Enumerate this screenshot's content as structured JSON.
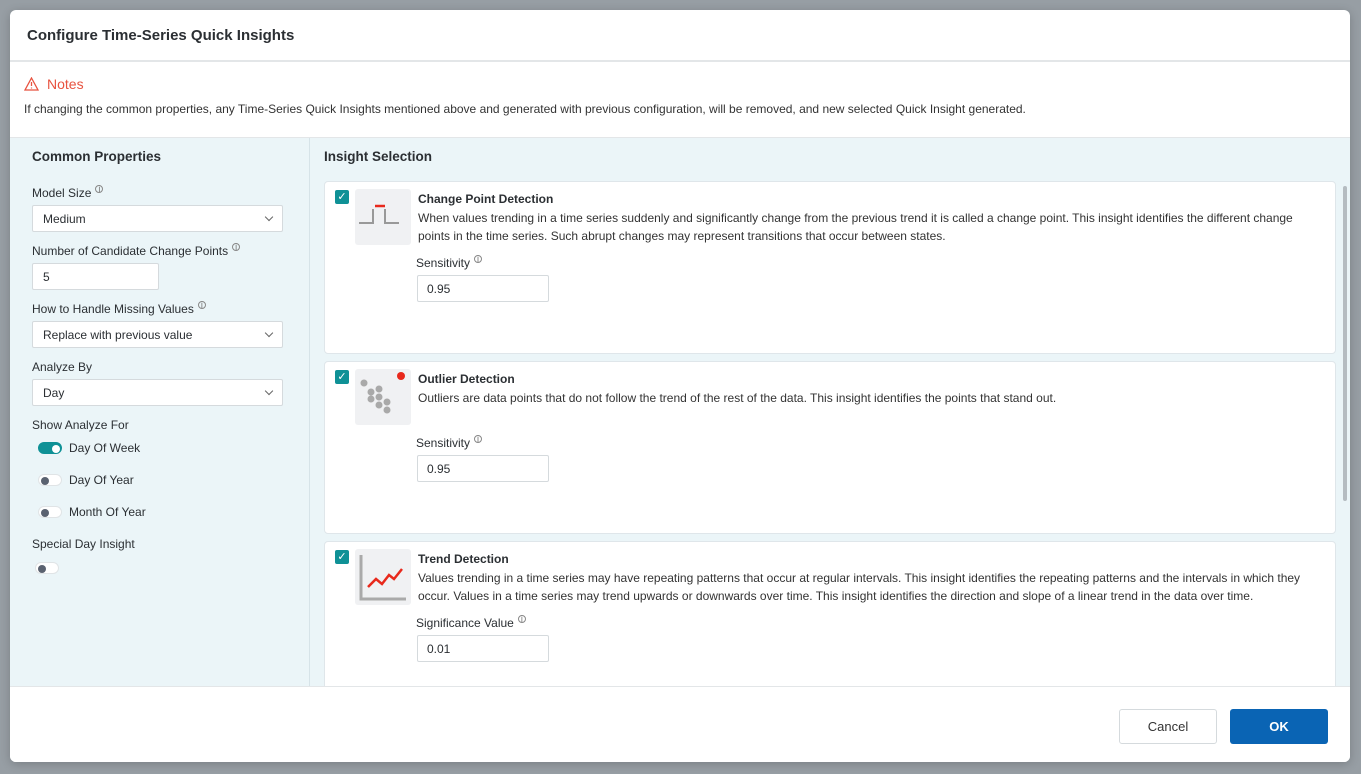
{
  "dialog": {
    "title": "Configure Time-Series Quick Insights"
  },
  "notes": {
    "title": "Notes",
    "text": "If changing the common properties, any Time-Series Quick Insights mentioned above and generated with previous configuration, will be removed, and new selected Quick Insight generated."
  },
  "common": {
    "title": "Common Properties",
    "model_size": {
      "label": "Model Size",
      "value": "Medium"
    },
    "candidates": {
      "label": "Number of Candidate Change Points",
      "value": "5"
    },
    "missing": {
      "label": "How to Handle Missing Values",
      "value": "Replace with previous value"
    },
    "analyze_by": {
      "label": "Analyze By",
      "value": "Day"
    },
    "show_for": {
      "label": "Show Analyze For",
      "items": [
        {
          "label": "Day Of Week",
          "on": true
        },
        {
          "label": "Day Of Year",
          "on": false
        },
        {
          "label": "Month Of Year",
          "on": false
        }
      ]
    },
    "special": {
      "label": "Special Day Insight",
      "on": false
    }
  },
  "insights": {
    "title": "Insight Selection",
    "cards": [
      {
        "title": "Change Point Detection",
        "checked": true,
        "icon": "change-point-icon",
        "desc": "When values trending in a time series suddenly and significantly change from the previous trend it is called a change point. This insight identifies the different change points in the time series. Such abrupt changes may represent transitions that occur between states.",
        "param_label": "Sensitivity",
        "param_value": "0.95"
      },
      {
        "title": "Outlier Detection",
        "checked": true,
        "icon": "outlier-icon",
        "desc": "Outliers are data points that do not follow the trend of the rest of the data. This insight identifies the points that stand out.",
        "param_label": "Sensitivity",
        "param_value": "0.95"
      },
      {
        "title": "Trend Detection",
        "checked": true,
        "icon": "trend-icon",
        "desc": "Values trending in a time series may have repeating patterns that occur at regular intervals. This insight identifies the repeating patterns and the intervals in which they occur. Values in a time series may trend upwards or downwards over time. This insight identifies the direction and slope of a linear trend in the data over time.",
        "param_label": "Significance Value",
        "param_value": "0.01"
      }
    ]
  },
  "footer": {
    "cancel": "Cancel",
    "ok": "OK"
  },
  "colors": {
    "accent": "#0f9196",
    "primary": "#0a64b4",
    "warning": "#e8523f"
  }
}
